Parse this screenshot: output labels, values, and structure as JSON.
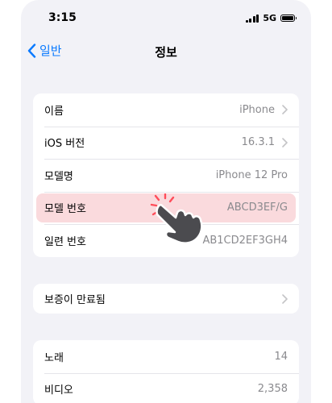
{
  "status_bar": {
    "time": "3:15",
    "network": "5G"
  },
  "nav": {
    "back_label": "일반",
    "title": "정보"
  },
  "info_group": [
    {
      "label": "이름",
      "value": "iPhone",
      "chevron": true
    },
    {
      "label": "iOS 버전",
      "value": "16.3.1",
      "chevron": true
    },
    {
      "label": "모델명",
      "value": "iPhone 12 Pro",
      "chevron": false
    },
    {
      "label": "모델 번호",
      "value": "ABCD3EF/G",
      "chevron": false,
      "highlighted": true
    },
    {
      "label": "일련 번호",
      "value": "AB1CD2EF3GH4",
      "chevron": false
    }
  ],
  "warranty": {
    "label": "보증이 만료됨"
  },
  "media_group": [
    {
      "label": "노래",
      "value": "14"
    },
    {
      "label": "비디오",
      "value": "2,358"
    }
  ],
  "colors": {
    "accent": "#0a7aff",
    "highlight": "#fadadd",
    "tap_indicator": "#ff4d5a",
    "background": "#f2f2f7"
  }
}
